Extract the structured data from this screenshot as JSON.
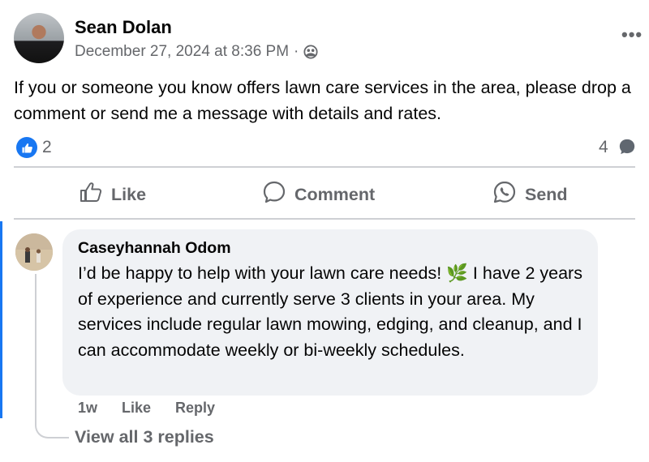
{
  "post": {
    "author": "Sean Dolan",
    "timestamp": "December 27, 2024 at 8:36 PM",
    "separator": "·",
    "audience_icon": "friends-icon",
    "text": "If you or someone you know offers lawn care services in the area, please drop a comment or send me a message with details and rates.",
    "more_label": "•••"
  },
  "reactions": {
    "like_count": "2",
    "comment_count": "4"
  },
  "actions": {
    "like": "Like",
    "comment": "Comment",
    "send": "Send"
  },
  "comment": {
    "author": "Caseyhannah Odom",
    "text": "I’d be happy to help with your lawn care needs! 🌿 I have 2 years of experience and currently serve 3 clients in your area. My services include regular lawn mowing, edging, and cleanup, and I can accommodate weekly or bi-weekly schedules.",
    "time": "1w",
    "like_label": "Like",
    "reply_label": "Reply",
    "view_replies": "View all 3 replies"
  },
  "colors": {
    "accent": "#1877f2",
    "secondary_text": "#65676b",
    "bubble": "#f0f2f5"
  }
}
